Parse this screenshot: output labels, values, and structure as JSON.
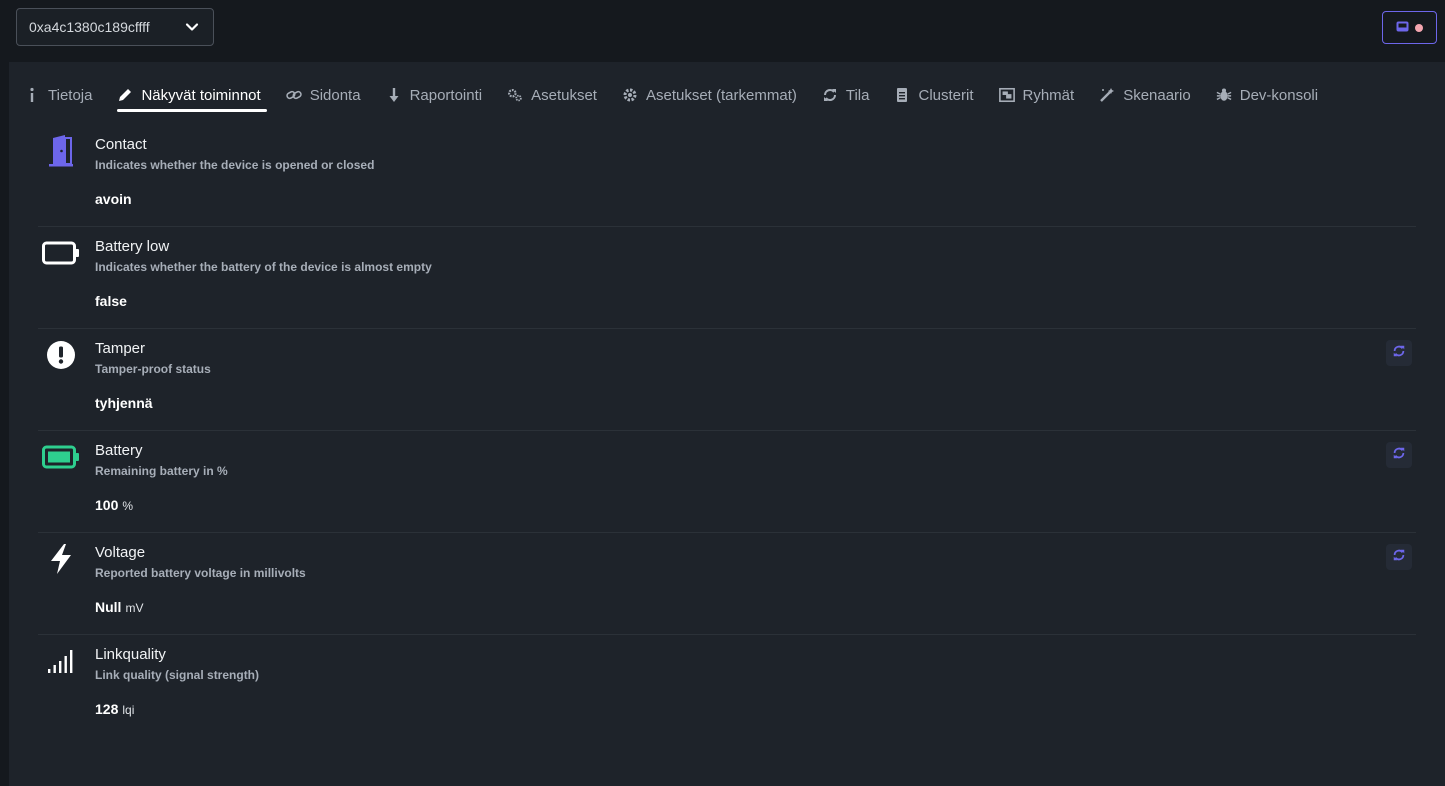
{
  "device": {
    "selected": "0xa4c1380c189cffff"
  },
  "tabs": [
    {
      "label": "Tietoja",
      "icon": "info-icon"
    },
    {
      "label": "Näkyvät toiminnot",
      "icon": "pencil-icon"
    },
    {
      "label": "Sidonta",
      "icon": "link-icon"
    },
    {
      "label": "Raportointi",
      "icon": "arrow-down-icon"
    },
    {
      "label": "Asetukset",
      "icon": "gears-icon"
    },
    {
      "label": "Asetukset (tarkemmat)",
      "icon": "gear-icon"
    },
    {
      "label": "Tila",
      "icon": "sync-icon"
    },
    {
      "label": "Clusterit",
      "icon": "document-icon"
    },
    {
      "label": "Ryhmät",
      "icon": "object-group-icon"
    },
    {
      "label": "Skenaario",
      "icon": "magic-wand-icon"
    },
    {
      "label": "Dev-konsoli",
      "icon": "bug-icon"
    }
  ],
  "active_tab": "Näkyvät toiminnot",
  "exposes": [
    {
      "name": "Contact",
      "description": "Indicates whether the device is opened or closed",
      "value": "avoin",
      "unit": "",
      "icon": "door-open-icon",
      "refresh": false
    },
    {
      "name": "Battery low",
      "description": "Indicates whether the battery of the device is almost empty",
      "value": "false",
      "unit": "",
      "icon": "battery-empty-icon",
      "refresh": false
    },
    {
      "name": "Tamper",
      "description": "Tamper-proof status",
      "value": "tyhjennä",
      "unit": "",
      "icon": "exclamation-circle-icon",
      "refresh": true
    },
    {
      "name": "Battery",
      "description": "Remaining battery in %",
      "value": "100",
      "unit": "%",
      "icon": "battery-full-icon",
      "refresh": true
    },
    {
      "name": "Voltage",
      "description": "Reported battery voltage in millivolts",
      "value": "Null",
      "unit": "mV",
      "icon": "bolt-icon",
      "refresh": true
    },
    {
      "name": "Linkquality",
      "description": "Link quality (signal strength)",
      "value": "128",
      "unit": "lqi",
      "icon": "signal-icon",
      "refresh": false
    }
  ],
  "colors": {
    "accent": "#6d66ea",
    "battery_full": "#2ecf8f",
    "background": "#1e232a",
    "notification_dot": "#f4a6b0"
  }
}
